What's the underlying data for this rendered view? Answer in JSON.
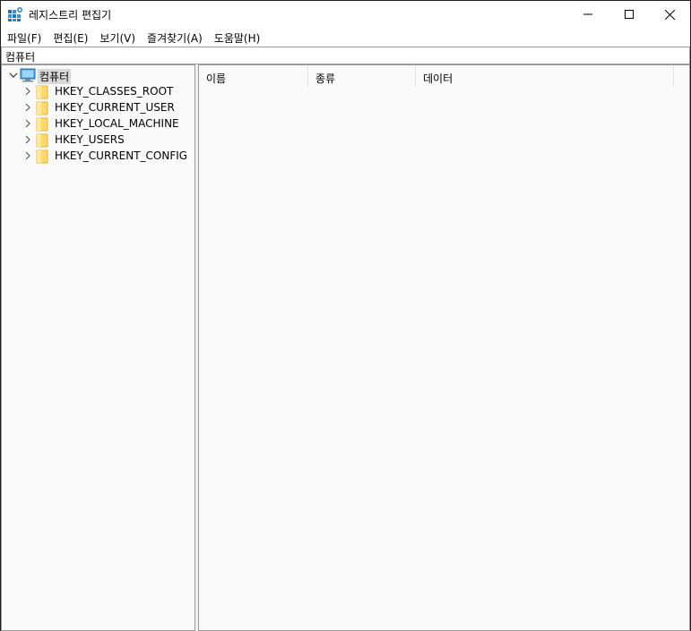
{
  "window": {
    "title": "레지스트리 편집기",
    "icon": "registry-editor-icon",
    "controls": {
      "minimize": "minimize-icon",
      "maximize": "maximize-icon",
      "close": "close-icon"
    }
  },
  "menu": [
    {
      "label": "파일(F)"
    },
    {
      "label": "편집(E)"
    },
    {
      "label": "보기(V)"
    },
    {
      "label": "즐겨찾기(A)"
    },
    {
      "label": "도움말(H)"
    }
  ],
  "address": {
    "value": "컴퓨터"
  },
  "tree": {
    "root": {
      "label": "컴퓨터",
      "icon": "computer-icon",
      "expanded": true,
      "selected": true
    },
    "children": [
      {
        "label": "HKEY_CLASSES_ROOT",
        "icon": "folder-icon",
        "expanded": false
      },
      {
        "label": "HKEY_CURRENT_USER",
        "icon": "folder-icon",
        "expanded": false
      },
      {
        "label": "HKEY_LOCAL_MACHINE",
        "icon": "folder-icon",
        "expanded": false
      },
      {
        "label": "HKEY_USERS",
        "icon": "folder-icon",
        "expanded": false
      },
      {
        "label": "HKEY_CURRENT_CONFIG",
        "icon": "folder-icon",
        "expanded": false
      }
    ]
  },
  "list": {
    "columns": [
      {
        "label": "이름"
      },
      {
        "label": "종류"
      },
      {
        "label": "데이터"
      }
    ],
    "rows": []
  },
  "colors": {
    "accent": "#0078d7",
    "folder": "#ffd86b",
    "selection": "#d9d9d9"
  }
}
